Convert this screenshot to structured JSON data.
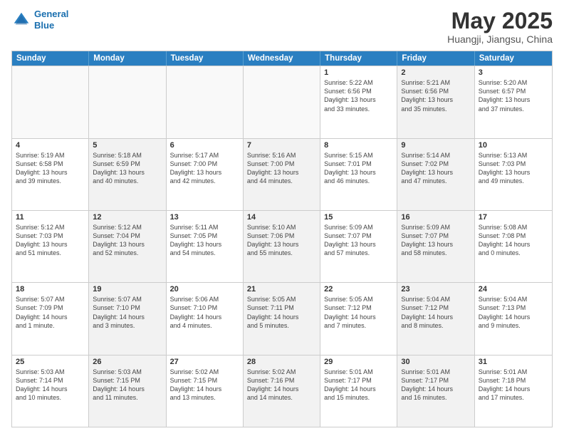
{
  "header": {
    "logo_line1": "General",
    "logo_line2": "Blue",
    "month": "May 2025",
    "location": "Huangji, Jiangsu, China"
  },
  "days_of_week": [
    "Sunday",
    "Monday",
    "Tuesday",
    "Wednesday",
    "Thursday",
    "Friday",
    "Saturday"
  ],
  "weeks": [
    [
      {
        "day": "",
        "info": ""
      },
      {
        "day": "",
        "info": ""
      },
      {
        "day": "",
        "info": ""
      },
      {
        "day": "",
        "info": ""
      },
      {
        "day": "1",
        "info": "Sunrise: 5:22 AM\nSunset: 6:56 PM\nDaylight: 13 hours\nand 33 minutes."
      },
      {
        "day": "2",
        "info": "Sunrise: 5:21 AM\nSunset: 6:56 PM\nDaylight: 13 hours\nand 35 minutes."
      },
      {
        "day": "3",
        "info": "Sunrise: 5:20 AM\nSunset: 6:57 PM\nDaylight: 13 hours\nand 37 minutes."
      }
    ],
    [
      {
        "day": "4",
        "info": "Sunrise: 5:19 AM\nSunset: 6:58 PM\nDaylight: 13 hours\nand 39 minutes."
      },
      {
        "day": "5",
        "info": "Sunrise: 5:18 AM\nSunset: 6:59 PM\nDaylight: 13 hours\nand 40 minutes."
      },
      {
        "day": "6",
        "info": "Sunrise: 5:17 AM\nSunset: 7:00 PM\nDaylight: 13 hours\nand 42 minutes."
      },
      {
        "day": "7",
        "info": "Sunrise: 5:16 AM\nSunset: 7:00 PM\nDaylight: 13 hours\nand 44 minutes."
      },
      {
        "day": "8",
        "info": "Sunrise: 5:15 AM\nSunset: 7:01 PM\nDaylight: 13 hours\nand 46 minutes."
      },
      {
        "day": "9",
        "info": "Sunrise: 5:14 AM\nSunset: 7:02 PM\nDaylight: 13 hours\nand 47 minutes."
      },
      {
        "day": "10",
        "info": "Sunrise: 5:13 AM\nSunset: 7:03 PM\nDaylight: 13 hours\nand 49 minutes."
      }
    ],
    [
      {
        "day": "11",
        "info": "Sunrise: 5:12 AM\nSunset: 7:03 PM\nDaylight: 13 hours\nand 51 minutes."
      },
      {
        "day": "12",
        "info": "Sunrise: 5:12 AM\nSunset: 7:04 PM\nDaylight: 13 hours\nand 52 minutes."
      },
      {
        "day": "13",
        "info": "Sunrise: 5:11 AM\nSunset: 7:05 PM\nDaylight: 13 hours\nand 54 minutes."
      },
      {
        "day": "14",
        "info": "Sunrise: 5:10 AM\nSunset: 7:06 PM\nDaylight: 13 hours\nand 55 minutes."
      },
      {
        "day": "15",
        "info": "Sunrise: 5:09 AM\nSunset: 7:07 PM\nDaylight: 13 hours\nand 57 minutes."
      },
      {
        "day": "16",
        "info": "Sunrise: 5:09 AM\nSunset: 7:07 PM\nDaylight: 13 hours\nand 58 minutes."
      },
      {
        "day": "17",
        "info": "Sunrise: 5:08 AM\nSunset: 7:08 PM\nDaylight: 14 hours\nand 0 minutes."
      }
    ],
    [
      {
        "day": "18",
        "info": "Sunrise: 5:07 AM\nSunset: 7:09 PM\nDaylight: 14 hours\nand 1 minute."
      },
      {
        "day": "19",
        "info": "Sunrise: 5:07 AM\nSunset: 7:10 PM\nDaylight: 14 hours\nand 3 minutes."
      },
      {
        "day": "20",
        "info": "Sunrise: 5:06 AM\nSunset: 7:10 PM\nDaylight: 14 hours\nand 4 minutes."
      },
      {
        "day": "21",
        "info": "Sunrise: 5:05 AM\nSunset: 7:11 PM\nDaylight: 14 hours\nand 5 minutes."
      },
      {
        "day": "22",
        "info": "Sunrise: 5:05 AM\nSunset: 7:12 PM\nDaylight: 14 hours\nand 7 minutes."
      },
      {
        "day": "23",
        "info": "Sunrise: 5:04 AM\nSunset: 7:12 PM\nDaylight: 14 hours\nand 8 minutes."
      },
      {
        "day": "24",
        "info": "Sunrise: 5:04 AM\nSunset: 7:13 PM\nDaylight: 14 hours\nand 9 minutes."
      }
    ],
    [
      {
        "day": "25",
        "info": "Sunrise: 5:03 AM\nSunset: 7:14 PM\nDaylight: 14 hours\nand 10 minutes."
      },
      {
        "day": "26",
        "info": "Sunrise: 5:03 AM\nSunset: 7:15 PM\nDaylight: 14 hours\nand 11 minutes."
      },
      {
        "day": "27",
        "info": "Sunrise: 5:02 AM\nSunset: 7:15 PM\nDaylight: 14 hours\nand 13 minutes."
      },
      {
        "day": "28",
        "info": "Sunrise: 5:02 AM\nSunset: 7:16 PM\nDaylight: 14 hours\nand 14 minutes."
      },
      {
        "day": "29",
        "info": "Sunrise: 5:01 AM\nSunset: 7:17 PM\nDaylight: 14 hours\nand 15 minutes."
      },
      {
        "day": "30",
        "info": "Sunrise: 5:01 AM\nSunset: 7:17 PM\nDaylight: 14 hours\nand 16 minutes."
      },
      {
        "day": "31",
        "info": "Sunrise: 5:01 AM\nSunset: 7:18 PM\nDaylight: 14 hours\nand 17 minutes."
      }
    ]
  ]
}
